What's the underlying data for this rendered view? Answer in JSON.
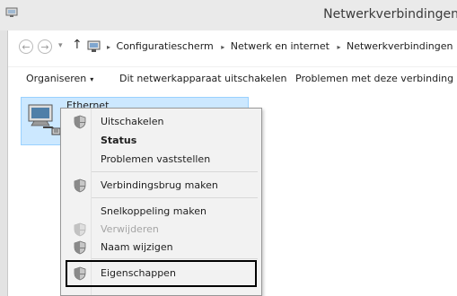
{
  "window": {
    "title": "Netwerkverbindingen"
  },
  "nav": {
    "back_glyph": "←",
    "forward_glyph": "→",
    "recent_glyph": "▾",
    "up_glyph": "↑"
  },
  "breadcrumb": {
    "items": [
      "Configuratiescherm",
      "Netwerk en internet",
      "Netwerkverbindingen"
    ],
    "separator": "▸"
  },
  "toolbar": {
    "organize_label": "Organiseren",
    "organize_caret": "▾",
    "disable_label": "Dit netwerkapparaat uitschakelen",
    "diagnose_label": "Problemen met deze verbinding va"
  },
  "adapter": {
    "name": "Ethernet",
    "icon": "network-adapter-icon"
  },
  "context_menu": {
    "items": [
      {
        "label": "Uitschakelen",
        "icon": "shield-icon",
        "bold": false,
        "disabled": false
      },
      {
        "label": "Status",
        "icon": "",
        "bold": true,
        "disabled": false
      },
      {
        "label": "Problemen vaststellen",
        "icon": "",
        "bold": false,
        "disabled": false
      },
      {
        "label": "Verbindingsbrug maken",
        "icon": "shield-icon",
        "bold": false,
        "disabled": false
      },
      {
        "label": "Snelkoppeling maken",
        "icon": "",
        "bold": false,
        "disabled": false
      },
      {
        "label": "Verwijderen",
        "icon": "shield-icon",
        "bold": false,
        "disabled": true
      },
      {
        "label": "Naam wijzigen",
        "icon": "shield-icon",
        "bold": false,
        "disabled": false
      },
      {
        "label": "Eigenschappen",
        "icon": "shield-icon",
        "bold": false,
        "disabled": false
      }
    ],
    "highlighted_item": "Eigenschappen"
  },
  "colors": {
    "selection": "#cce8ff",
    "selection_border": "#99d1ff",
    "menu_bg": "#f2f2f2",
    "highlight_frame": "#000000"
  }
}
